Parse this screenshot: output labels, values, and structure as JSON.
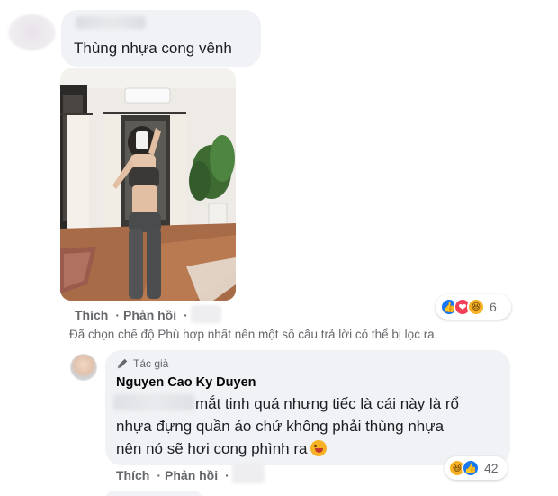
{
  "comment1": {
    "text": "Thùng nhựa cong vênh",
    "actions": {
      "like": "Thích",
      "reply": "Phản hồi",
      "separator": "·"
    },
    "reactions": {
      "icons": [
        "like-icon",
        "love-icon",
        "haha-icon"
      ],
      "count": "6"
    }
  },
  "filter_note": "Đã chọn chế độ Phù hợp nhất nên một số câu trả lời có thể bị lọc ra.",
  "comment2": {
    "badge": "Tác giả",
    "author": "Nguyen Cao Ky Duyen",
    "lines": [
      "mắt tinh quá nhưng tiếc là cái này là rổ",
      "nhựa đựng quần áo chứ không phải thùng nhựa",
      "nên nó sẽ hơi cong phình ra"
    ],
    "actions": {
      "like": "Thích",
      "reply": "Phản hồi",
      "separator": "·"
    },
    "reactions": {
      "icons": [
        "haha-icon",
        "like-icon"
      ],
      "count": "42"
    }
  },
  "colors": {
    "bubble": "#f0f2f5",
    "secondary_text": "#65676b",
    "like_blue": "#1877f2",
    "love_red": "#f33e58",
    "haha_yellow": "#f7b125"
  }
}
